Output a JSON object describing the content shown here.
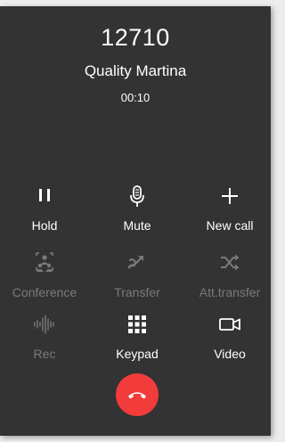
{
  "call": {
    "number": "12710",
    "name": "Quality Martina",
    "timer": "00:10"
  },
  "controls": {
    "hold": {
      "label": "Hold",
      "icon": "pause-icon",
      "enabled": true
    },
    "mute": {
      "label": "Mute",
      "icon": "microphone-icon",
      "enabled": true
    },
    "new_call": {
      "label": "New call",
      "icon": "plus-icon",
      "enabled": true
    },
    "conference": {
      "label": "Conference",
      "icon": "conference-icon",
      "enabled": false
    },
    "transfer": {
      "label": "Transfer",
      "icon": "transfer-icon",
      "enabled": false
    },
    "att_transfer": {
      "label": "Att.transfer",
      "icon": "shuffle-icon",
      "enabled": false
    },
    "rec": {
      "label": "Rec",
      "icon": "waveform-icon",
      "enabled": false
    },
    "keypad": {
      "label": "Keypad",
      "icon": "keypad-grid-icon",
      "enabled": true
    },
    "video": {
      "label": "Video",
      "icon": "video-camera-icon",
      "enabled": true
    }
  },
  "hangup": {
    "icon": "hang-up-phone-icon",
    "color": "#f23b3b"
  },
  "colors": {
    "background": "#333333",
    "text": "#ffffff",
    "disabled": "#7a7a7a"
  }
}
